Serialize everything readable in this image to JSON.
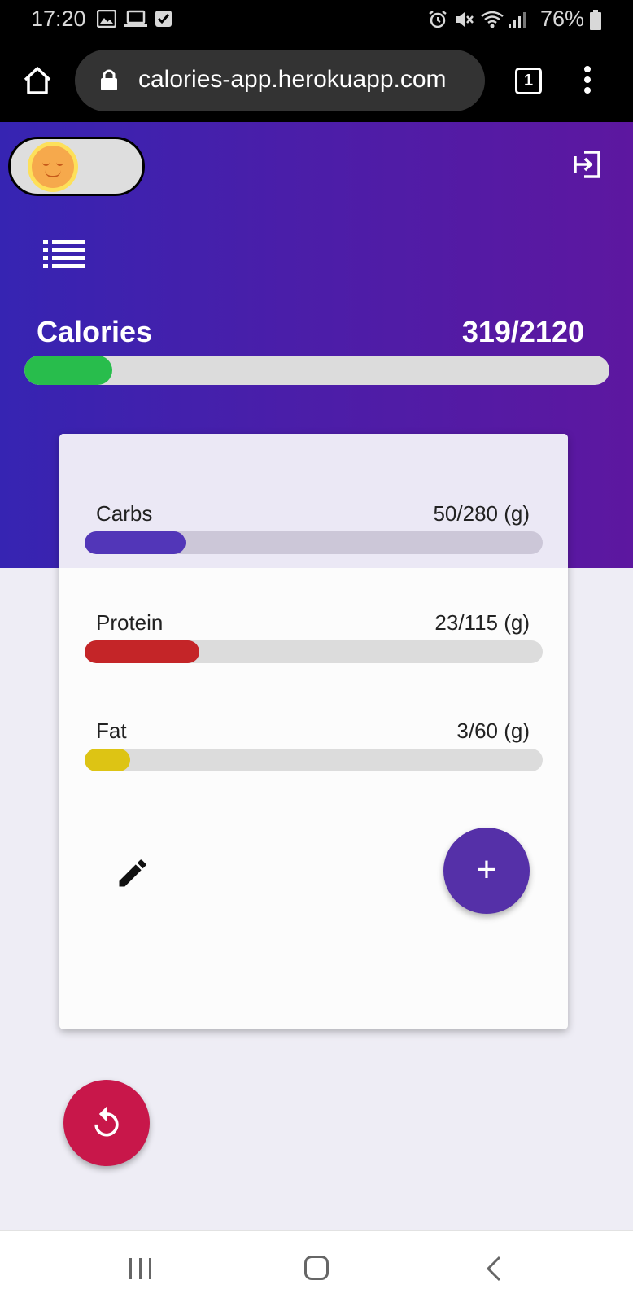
{
  "status_bar": {
    "time": "17:20",
    "battery": "76%",
    "left_icons": [
      "image-icon",
      "laptop-icon",
      "checkbox-icon"
    ],
    "right_icons": [
      "alarm-icon",
      "mute-icon",
      "wifi-icon",
      "signal-icon",
      "battery-icon"
    ]
  },
  "browser": {
    "url": "calories-app.herokuapp.com",
    "tab_count": "1"
  },
  "header": {
    "theme_mode": "light",
    "calories_label": "Calories",
    "calories_value": "319/2120",
    "calories_progress": 0.15,
    "calories_color": "#28bd4c"
  },
  "macros": [
    {
      "name": "Carbs",
      "value": "50/280 (g)",
      "progress": 0.22,
      "color": "#5236b8"
    },
    {
      "name": "Protein",
      "value": "23/115 (g)",
      "progress": 0.25,
      "color": "#c42528"
    },
    {
      "name": "Fat",
      "value": "3/60 (g)",
      "progress": 0.1,
      "color": "#ddc414"
    }
  ],
  "actions": {
    "add_label": "+"
  },
  "colors": {
    "header_gradient_start": "#3624b2",
    "header_gradient_end": "#5d17a0",
    "add_button": "#5530a8",
    "reset_button": "#c8174a"
  }
}
